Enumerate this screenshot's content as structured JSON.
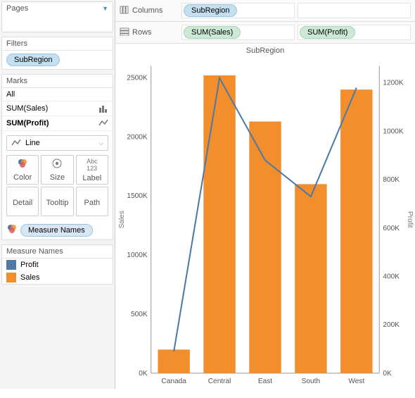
{
  "sidebar": {
    "pages_label": "Pages",
    "filters_label": "Filters",
    "filters_pill": "SubRegion",
    "marks_label": "Marks",
    "marks_rows": {
      "all": "All",
      "sum_sales": "SUM(Sales)",
      "sum_profit": "SUM(Profit)"
    },
    "dropdown_value": "Line",
    "mark_cells": {
      "color": "Color",
      "size": "Size",
      "label": "Label",
      "detail": "Detail",
      "tooltip": "Tooltip",
      "path": "Path"
    },
    "measure_names_pill": "Measure Names",
    "measure_names_label": "Measure Names",
    "legend": {
      "profit": {
        "label": "Profit",
        "color": "#4e79a7"
      },
      "sales": {
        "label": "Sales",
        "color": "#f28e2b"
      }
    }
  },
  "shelves": {
    "columns_label": "Columns",
    "columns_pill": "SubRegion",
    "rows_label": "Rows",
    "rows_pill1": "SUM(Sales)",
    "rows_pill2": "SUM(Profit)"
  },
  "chart": {
    "title": "SubRegion",
    "y_left_label": "Sales",
    "y_right_label": "Profit",
    "y_left_ticks": [
      "0K",
      "500K",
      "1000K",
      "1500K",
      "2000K",
      "2500K"
    ],
    "y_right_ticks": [
      "0K",
      "200K",
      "400K",
      "600K",
      "800K",
      "1000K",
      "1200K"
    ],
    "categories": [
      "Canada",
      "Central",
      "East",
      "South",
      "West"
    ]
  },
  "chart_data": {
    "type": "bar+line",
    "categories": [
      "Canada",
      "Central",
      "East",
      "South",
      "West"
    ],
    "series": [
      {
        "name": "Sales",
        "axis": "left",
        "type": "bar",
        "values": [
          200000,
          2520000,
          2130000,
          1600000,
          2400000
        ]
      },
      {
        "name": "Profit",
        "axis": "right",
        "type": "line",
        "values": [
          90000,
          1220000,
          880000,
          730000,
          1180000
        ]
      }
    ],
    "title": "SubRegion",
    "y_left": {
      "label": "Sales",
      "lim": [
        0,
        2600000
      ]
    },
    "y_right": {
      "label": "Profit",
      "lim": [
        0,
        1270000
      ]
    },
    "xlabel": ""
  }
}
